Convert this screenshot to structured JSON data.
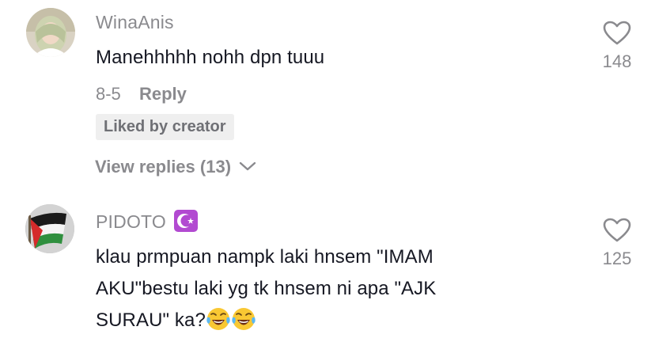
{
  "comments": [
    {
      "username": "WinaAnis",
      "text": "Manehhhhh nohh dpn tuuu",
      "date": "8-5",
      "reply_label": "Reply",
      "liked_badge": "Liked by creator",
      "view_replies": "View replies (13)",
      "likes": "148",
      "avatar_icon": "user-avatar-photo"
    },
    {
      "username": "PIDOTO",
      "username_badge_icon": "star-and-crescent-icon",
      "text_lines": [
        "klau prmpuan nampk laki hnsem \"IMAM",
        "AKU\"bestu laki yg tk hnsem ni apa \"AJK",
        "SURAU\" ka?"
      ],
      "trailing_emojis": [
        "laughing-tears-emoji",
        "laughing-tears-emoji"
      ],
      "likes": "125",
      "avatar_icon": "palestine-flag-avatar"
    }
  ],
  "colors": {
    "text_primary": "#161823",
    "text_secondary": "#8a8a8e",
    "badge_bg": "#efefef",
    "crescent_badge": "#b24ad1"
  }
}
